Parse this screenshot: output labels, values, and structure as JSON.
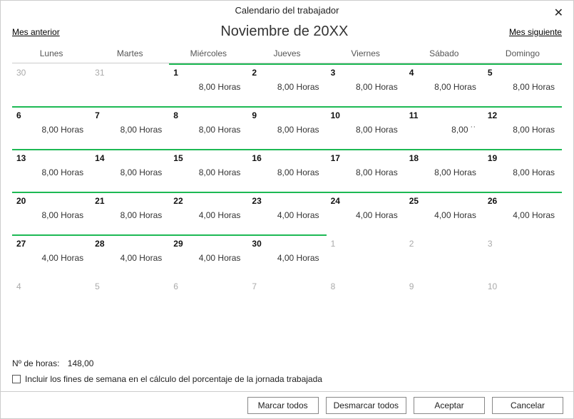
{
  "window": {
    "title": "Calendario del trabajador"
  },
  "nav": {
    "prev": "Mes anterior",
    "next": "Mes siguiente",
    "month": "Noviembre de 20XX"
  },
  "weekdays": [
    "Lunes",
    "Martes",
    "Miércoles",
    "Jueves",
    "Viernes",
    "Sábado",
    "Domingo"
  ],
  "cells": [
    {
      "d": "30",
      "muted": true,
      "active": false,
      "h": ""
    },
    {
      "d": "31",
      "muted": true,
      "active": false,
      "h": ""
    },
    {
      "d": "1",
      "muted": false,
      "active": true,
      "h": "8,00 Horas"
    },
    {
      "d": "2",
      "muted": false,
      "active": true,
      "h": "8,00 Horas"
    },
    {
      "d": "3",
      "muted": false,
      "active": true,
      "h": "8,00 Horas"
    },
    {
      "d": "4",
      "muted": false,
      "active": true,
      "h": "8,00 Horas"
    },
    {
      "d": "5",
      "muted": false,
      "active": true,
      "h": "8,00 Horas"
    },
    {
      "d": "6",
      "muted": false,
      "active": true,
      "h": "8,00 Horas"
    },
    {
      "d": "7",
      "muted": false,
      "active": true,
      "h": "8,00 Horas"
    },
    {
      "d": "8",
      "muted": false,
      "active": true,
      "h": "8,00 Horas"
    },
    {
      "d": "9",
      "muted": false,
      "active": true,
      "h": "8,00 Horas"
    },
    {
      "d": "10",
      "muted": false,
      "active": true,
      "h": "8,00 Horas"
    },
    {
      "d": "11",
      "muted": false,
      "active": true,
      "h": "8,00 ˙˙"
    },
    {
      "d": "12",
      "muted": false,
      "active": true,
      "h": "8,00 Horas"
    },
    {
      "d": "13",
      "muted": false,
      "active": true,
      "h": "8,00 Horas"
    },
    {
      "d": "14",
      "muted": false,
      "active": true,
      "h": "8,00 Horas"
    },
    {
      "d": "15",
      "muted": false,
      "active": true,
      "h": "8,00 Horas"
    },
    {
      "d": "16",
      "muted": false,
      "active": true,
      "h": "8,00 Horas"
    },
    {
      "d": "17",
      "muted": false,
      "active": true,
      "h": "8,00 Horas"
    },
    {
      "d": "18",
      "muted": false,
      "active": true,
      "h": "8,00 Horas"
    },
    {
      "d": "19",
      "muted": false,
      "active": true,
      "h": "8,00 Horas"
    },
    {
      "d": "20",
      "muted": false,
      "active": true,
      "h": "8,00 Horas"
    },
    {
      "d": "21",
      "muted": false,
      "active": true,
      "h": "8,00 Horas"
    },
    {
      "d": "22",
      "muted": false,
      "active": true,
      "h": "4,00 Horas"
    },
    {
      "d": "23",
      "muted": false,
      "active": true,
      "h": "4,00 Horas"
    },
    {
      "d": "24",
      "muted": false,
      "active": true,
      "h": "4,00 Horas"
    },
    {
      "d": "25",
      "muted": false,
      "active": true,
      "h": "4,00 Horas"
    },
    {
      "d": "26",
      "muted": false,
      "active": true,
      "h": "4,00 Horas"
    },
    {
      "d": "27",
      "muted": false,
      "active": true,
      "h": "4,00 Horas"
    },
    {
      "d": "28",
      "muted": false,
      "active": true,
      "h": "4,00 Horas"
    },
    {
      "d": "29",
      "muted": false,
      "active": true,
      "h": "4,00 Horas"
    },
    {
      "d": "30",
      "muted": false,
      "active": true,
      "h": "4,00 Horas"
    },
    {
      "d": "1",
      "muted": true,
      "active": false,
      "h": ""
    },
    {
      "d": "2",
      "muted": true,
      "active": false,
      "h": ""
    },
    {
      "d": "3",
      "muted": true,
      "active": false,
      "h": ""
    },
    {
      "d": "4",
      "muted": true,
      "active": false,
      "h": ""
    },
    {
      "d": "5",
      "muted": true,
      "active": false,
      "h": ""
    },
    {
      "d": "6",
      "muted": true,
      "active": false,
      "h": ""
    },
    {
      "d": "7",
      "muted": true,
      "active": false,
      "h": ""
    },
    {
      "d": "8",
      "muted": true,
      "active": false,
      "h": ""
    },
    {
      "d": "9",
      "muted": true,
      "active": false,
      "h": ""
    },
    {
      "d": "10",
      "muted": true,
      "active": false,
      "h": ""
    }
  ],
  "footer": {
    "total_label": "Nº de horas:",
    "total_value": "148,00",
    "checkbox_label": "Incluir los fines de semana en el cálculo del porcentaje de la jornada trabajada"
  },
  "buttons": {
    "mark_all": "Marcar todos",
    "unmark_all": "Desmarcar todos",
    "accept": "Aceptar",
    "cancel": "Cancelar"
  }
}
